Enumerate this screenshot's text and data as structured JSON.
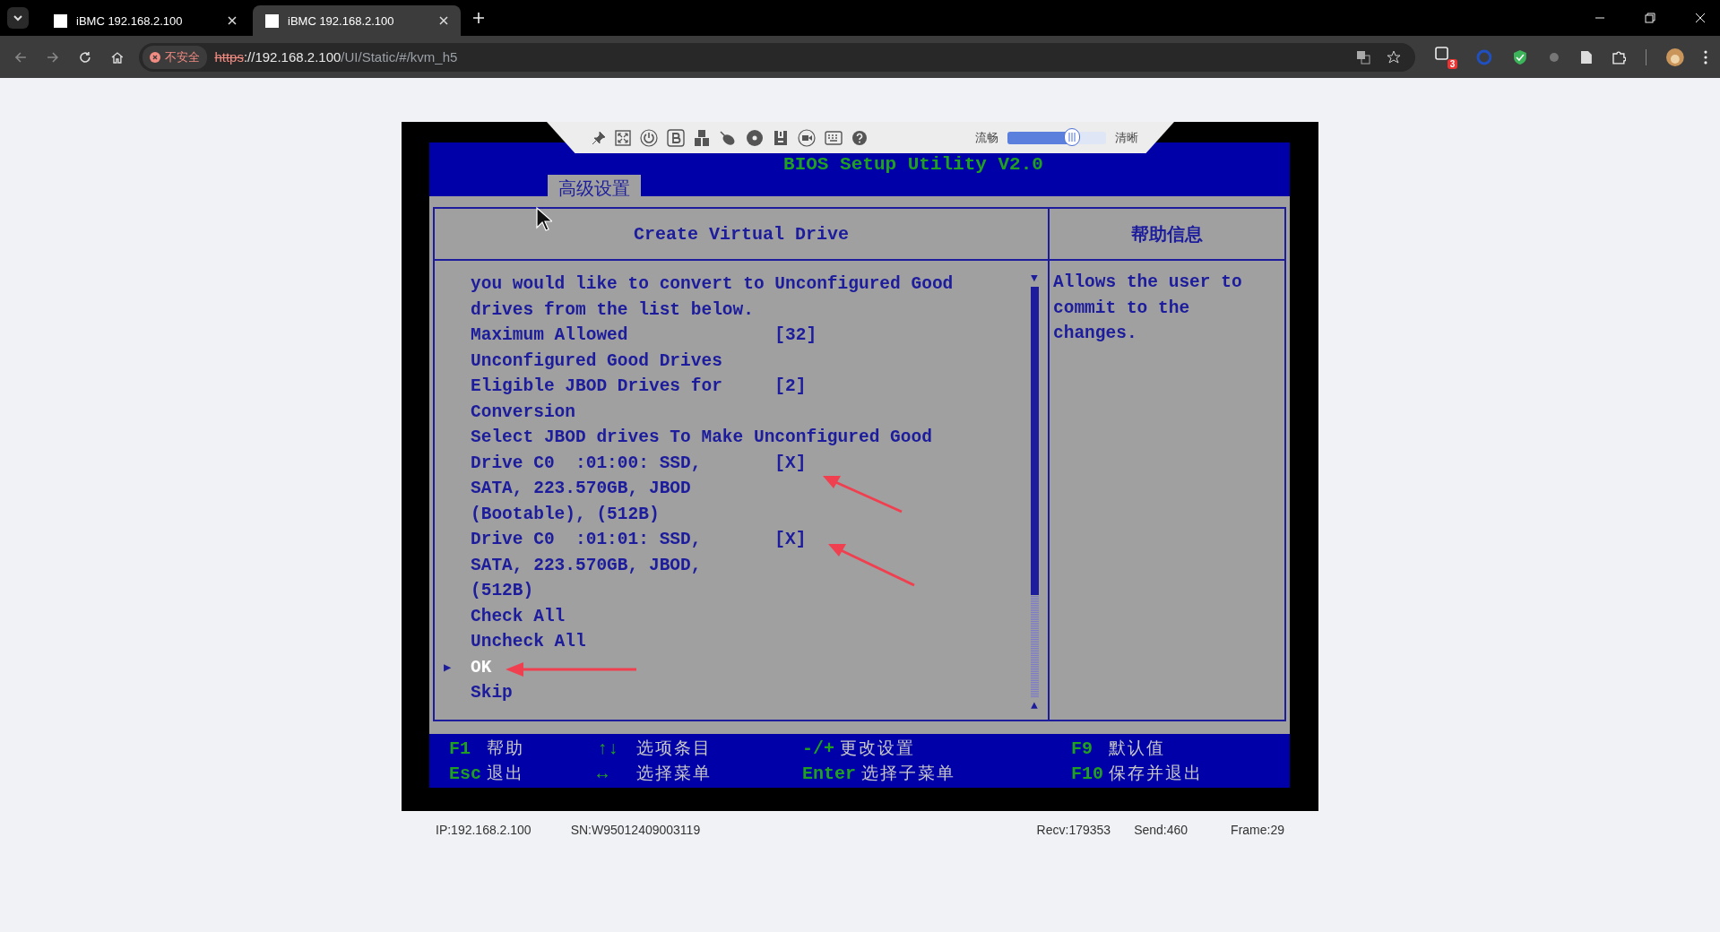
{
  "browser": {
    "tabs": [
      {
        "title": "iBMC 192.168.2.100",
        "selected": false
      },
      {
        "title": "iBMC 192.168.2.100",
        "selected": true
      }
    ],
    "security_label": "不安全",
    "url": {
      "scheme": "https",
      "rest_host": "://192.168.2.100",
      "path": "/UI/Static/#/kvm_h5"
    },
    "extension_badge": "3"
  },
  "kvm_toolbar": {
    "quality_low": "流畅",
    "quality_high": "清晰",
    "quality": {
      "level": 0.65
    }
  },
  "bios": {
    "title": "BIOS Setup Utility V2.0",
    "menu_tab": "高级设置",
    "panel_title": "Create Virtual Drive",
    "help_title": "帮助信息",
    "help_text": "Allows the user to commit to the changes.",
    "scroll_down": "▼",
    "scroll_up": "▲",
    "pointer": "▶",
    "items": [
      {
        "label": "you would like to convert to Unconfigured Good",
        "selected": false
      },
      {
        "label": "drives from the list below.",
        "selected": false
      },
      {
        "label": "Maximum Allowed",
        "value": "[32]",
        "selected": false
      },
      {
        "label": "Unconfigured Good Drives",
        "selected": false
      },
      {
        "label": "Eligible JBOD Drives for",
        "value": "[2]",
        "selected": false
      },
      {
        "label": "Conversion",
        "selected": false
      },
      {
        "label": "Select JBOD drives To Make Unconfigured Good",
        "selected": false
      },
      {
        "label": "Drive C0  :01:00: SSD,",
        "value": "[X]",
        "selected": false
      },
      {
        "label": "SATA, 223.570GB, JBOD",
        "selected": false
      },
      {
        "label": "(Bootable), (512B)",
        "selected": false
      },
      {
        "label": "Drive C0  :01:01: SSD,",
        "value": "[X]",
        "selected": false
      },
      {
        "label": "SATA, 223.570GB, JBOD,",
        "selected": false
      },
      {
        "label": "(512B)",
        "selected": false
      },
      {
        "label": "Check All",
        "selected": false
      },
      {
        "label": "Uncheck All",
        "selected": false
      },
      {
        "label": "OK",
        "selected": true
      },
      {
        "label": "Skip",
        "selected": false
      }
    ],
    "keys": [
      [
        {
          "key": "F1",
          "action": "帮助"
        },
        {
          "key": "↑↓",
          "action": "选项条目"
        },
        {
          "key": "-/+",
          "action": "更改设置"
        },
        {
          "key": "F9",
          "action": "默认值"
        }
      ],
      [
        {
          "key": "Esc",
          "action": "退出"
        },
        {
          "key": "↔",
          "action": "选择菜单"
        },
        {
          "key": "Enter",
          "action": "选择子菜单"
        },
        {
          "key": "F10",
          "action": "保存并退出"
        }
      ]
    ]
  },
  "status_bar": {
    "ip": "IP:192.168.2.100",
    "sn": "SN:W95012409003119",
    "recv": "Recv:179353",
    "send": "Send:460",
    "frame": "Frame:29"
  }
}
